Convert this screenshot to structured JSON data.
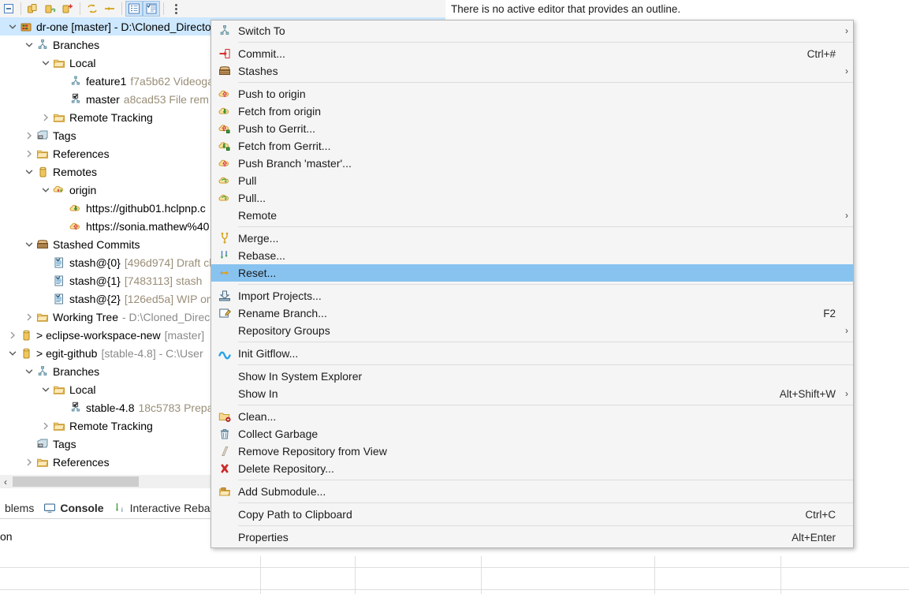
{
  "toolbar": {
    "buttons": [
      {
        "name": "collapse-all-icon",
        "glyph": "collapse-all"
      },
      {
        "name": "clone-repository-icon",
        "glyph": "clone-repo"
      },
      {
        "name": "add-repository-icon",
        "glyph": "add-repo"
      },
      {
        "name": "create-repository-icon",
        "glyph": "create-repo"
      },
      {
        "name": "refresh-icon",
        "glyph": "refresh"
      },
      {
        "name": "link-with-selection-icon",
        "glyph": "link-selection"
      },
      {
        "name": "hierarchy-layout-icon",
        "glyph": "hierarchy",
        "active": true
      },
      {
        "name": "flat-layout-icon",
        "glyph": "flat",
        "active": true
      },
      {
        "name": "view-menu-icon",
        "glyph": "view-menu"
      }
    ]
  },
  "outline": {
    "message": "There is no active editor that provides an outline."
  },
  "tree": {
    "rows": [
      {
        "indent": 0,
        "twisty": "down",
        "icon": "repository-icon",
        "label": "dr-one [master] - D:\\Cloned_Directories\\dr-one-release\\dr-one\\.git",
        "selected": true
      },
      {
        "indent": 1,
        "twisty": "down",
        "icon": "branches-icon",
        "label": "Branches"
      },
      {
        "indent": 2,
        "twisty": "down",
        "icon": "folder-icon",
        "label": "Local"
      },
      {
        "indent": 3,
        "twisty": "none",
        "icon": "branch-icon",
        "label": "feature1",
        "sub": "f7a5b62 Videoga"
      },
      {
        "indent": 3,
        "twisty": "none",
        "icon": "checked-branch-icon",
        "label": "master",
        "sub": "a8cad53  File rem"
      },
      {
        "indent": 2,
        "twisty": "right",
        "icon": "folder-icon",
        "label": "Remote Tracking"
      },
      {
        "indent": 1,
        "twisty": "right",
        "icon": "tags-icon",
        "label": "Tags"
      },
      {
        "indent": 1,
        "twisty": "right",
        "icon": "folder-icon",
        "label": "References"
      },
      {
        "indent": 1,
        "twisty": "down",
        "icon": "remotes-icon",
        "label": "Remotes"
      },
      {
        "indent": 2,
        "twisty": "down",
        "icon": "remote-origin-icon",
        "label": "origin"
      },
      {
        "indent": 3,
        "twisty": "none",
        "icon": "fetch-cloud-icon",
        "label": "https://github01.hclpnp.c"
      },
      {
        "indent": 3,
        "twisty": "none",
        "icon": "push-cloud-icon",
        "label": "https://sonia.mathew%40"
      },
      {
        "indent": 1,
        "twisty": "down",
        "icon": "stash-icon",
        "label": "Stashed Commits"
      },
      {
        "indent": 2,
        "twisty": "none",
        "icon": "commit-icon",
        "label": "stash@{0}",
        "sub": "[496d974] Draft cl"
      },
      {
        "indent": 2,
        "twisty": "none",
        "icon": "commit-icon",
        "label": "stash@{1}",
        "sub": "[7483113] stash"
      },
      {
        "indent": 2,
        "twisty": "none",
        "icon": "commit-icon",
        "label": "stash@{2}",
        "sub": "[126ed5a] WIP on"
      },
      {
        "indent": 1,
        "twisty": "right",
        "icon": "folder-icon",
        "label": "Working Tree",
        "sub2": "- D:\\Cloned_Direc"
      },
      {
        "indent": 0,
        "twisty": "right",
        "icon": "repository-collapsed-icon",
        "label": "> eclipse-workspace-new",
        "sub2": "[master]"
      },
      {
        "indent": 0,
        "twisty": "down",
        "icon": "repository-collapsed-icon",
        "label": "> egit-github",
        "sub2": "[stable-4.8] - C:\\User"
      },
      {
        "indent": 1,
        "twisty": "down",
        "icon": "branches-icon",
        "label": "Branches"
      },
      {
        "indent": 2,
        "twisty": "down",
        "icon": "folder-icon",
        "label": "Local"
      },
      {
        "indent": 3,
        "twisty": "none",
        "icon": "checked-branch-icon",
        "label": "stable-4.8",
        "sub": "18c5783 Prepa"
      },
      {
        "indent": 2,
        "twisty": "right",
        "icon": "folder-icon",
        "label": "Remote Tracking"
      },
      {
        "indent": 1,
        "twisty": "none",
        "icon": "tags-icon",
        "label": "Tags"
      },
      {
        "indent": 1,
        "twisty": "right",
        "icon": "folder-icon",
        "label": "References"
      },
      {
        "indent": 1,
        "twisty": "none",
        "icon": "remotes-icon",
        "label": "Remotes"
      }
    ]
  },
  "scrollbar": {
    "left_arrow": "‹"
  },
  "bottom_tabs": [
    {
      "label": "blems",
      "icon": "problems-icon",
      "active": false
    },
    {
      "label": "Console",
      "icon": "console-icon",
      "active": true
    },
    {
      "label": "Interactive Rebase",
      "icon": "rebase-icon",
      "active": false
    }
  ],
  "tab_body": {
    "text": "on"
  },
  "context_menu": {
    "items": [
      {
        "type": "item",
        "name": "switch-to",
        "icon": "branches-icon",
        "label": "Switch To",
        "accel": "",
        "submenu": true
      },
      {
        "type": "sep"
      },
      {
        "type": "item",
        "name": "commit",
        "icon": "commit-arrow-icon",
        "label": "Commit...",
        "accel": "Ctrl+#",
        "submenu": false
      },
      {
        "type": "item",
        "name": "stashes",
        "icon": "stash-icon",
        "label": "Stashes",
        "accel": "",
        "submenu": true
      },
      {
        "type": "sep"
      },
      {
        "type": "item",
        "name": "push-to-origin",
        "icon": "push-cloud-icon",
        "label": "Push to origin",
        "accel": "",
        "submenu": false
      },
      {
        "type": "item",
        "name": "fetch-from-origin",
        "icon": "fetch-cloud-icon",
        "label": "Fetch from origin",
        "accel": "",
        "submenu": false
      },
      {
        "type": "item",
        "name": "push-to-gerrit",
        "icon": "push-gerrit-icon",
        "label": "Push to Gerrit...",
        "accel": "",
        "submenu": false
      },
      {
        "type": "item",
        "name": "fetch-from-gerrit",
        "icon": "fetch-gerrit-icon",
        "label": "Fetch from Gerrit...",
        "accel": "",
        "submenu": false
      },
      {
        "type": "item",
        "name": "push-branch-master",
        "icon": "push-cloud-icon",
        "label": "Push Branch 'master'...",
        "accel": "",
        "submenu": false
      },
      {
        "type": "item",
        "name": "pull",
        "icon": "pull-cloud-icon",
        "label": "Pull",
        "accel": "",
        "submenu": false
      },
      {
        "type": "item",
        "name": "pull-dialog",
        "icon": "pull-cloud-icon",
        "label": "Pull...",
        "accel": "",
        "submenu": false
      },
      {
        "type": "item",
        "name": "remote",
        "icon": "none",
        "label": "Remote",
        "accel": "",
        "submenu": true
      },
      {
        "type": "sep"
      },
      {
        "type": "item",
        "name": "merge",
        "icon": "merge-icon",
        "label": "Merge...",
        "accel": "",
        "submenu": false
      },
      {
        "type": "item",
        "name": "rebase",
        "icon": "rebase-icon",
        "label": "Rebase...",
        "accel": "",
        "submenu": false
      },
      {
        "type": "item",
        "name": "reset",
        "icon": "reset-icon",
        "label": "Reset...",
        "accel": "",
        "submenu": false,
        "highlight": true
      },
      {
        "type": "sep"
      },
      {
        "type": "item",
        "name": "import-projects",
        "icon": "import-icon",
        "label": "Import Projects...",
        "accel": "",
        "submenu": false
      },
      {
        "type": "item",
        "name": "rename-branch",
        "icon": "rename-icon",
        "label": "Rename Branch...",
        "accel": "F2",
        "submenu": false
      },
      {
        "type": "item",
        "name": "repository-groups",
        "icon": "none",
        "label": "Repository Groups",
        "accel": "",
        "submenu": true
      },
      {
        "type": "sep"
      },
      {
        "type": "item",
        "name": "init-gitflow",
        "icon": "gitflow-icon",
        "label": "Init Gitflow...",
        "accel": "",
        "submenu": false
      },
      {
        "type": "sep"
      },
      {
        "type": "item",
        "name": "show-in-system-explorer",
        "icon": "none",
        "label": "Show In System Explorer",
        "accel": "",
        "submenu": false
      },
      {
        "type": "item",
        "name": "show-in",
        "icon": "none",
        "label": "Show In",
        "accel": "Alt+Shift+W",
        "submenu": true
      },
      {
        "type": "sep"
      },
      {
        "type": "item",
        "name": "clean",
        "icon": "clean-icon",
        "label": "Clean...",
        "accel": "",
        "submenu": false
      },
      {
        "type": "item",
        "name": "collect-garbage",
        "icon": "trash-icon",
        "label": "Collect Garbage",
        "accel": "",
        "submenu": false
      },
      {
        "type": "item",
        "name": "remove-repository-from-view",
        "icon": "remove-icon",
        "label": "Remove Repository from View",
        "accel": "",
        "submenu": false
      },
      {
        "type": "item",
        "name": "delete-repository",
        "icon": "delete-x-icon",
        "label": "Delete Repository...",
        "accel": "",
        "submenu": false
      },
      {
        "type": "sep"
      },
      {
        "type": "item",
        "name": "add-submodule",
        "icon": "submodule-icon",
        "label": "Add Submodule...",
        "accel": "",
        "submenu": false
      },
      {
        "type": "sep"
      },
      {
        "type": "item",
        "name": "copy-path-to-clipboard",
        "icon": "none",
        "label": "Copy Path to Clipboard",
        "accel": "Ctrl+C",
        "submenu": false
      },
      {
        "type": "sep"
      },
      {
        "type": "item",
        "name": "properties",
        "icon": "none",
        "label": "Properties",
        "accel": "Alt+Enter",
        "submenu": false
      }
    ]
  },
  "colors": {
    "menu_bg": "#f5f5f5",
    "highlight": "#88c3f0",
    "tree_selection": "#cde8ff",
    "sub_text": "#9a8e78"
  }
}
